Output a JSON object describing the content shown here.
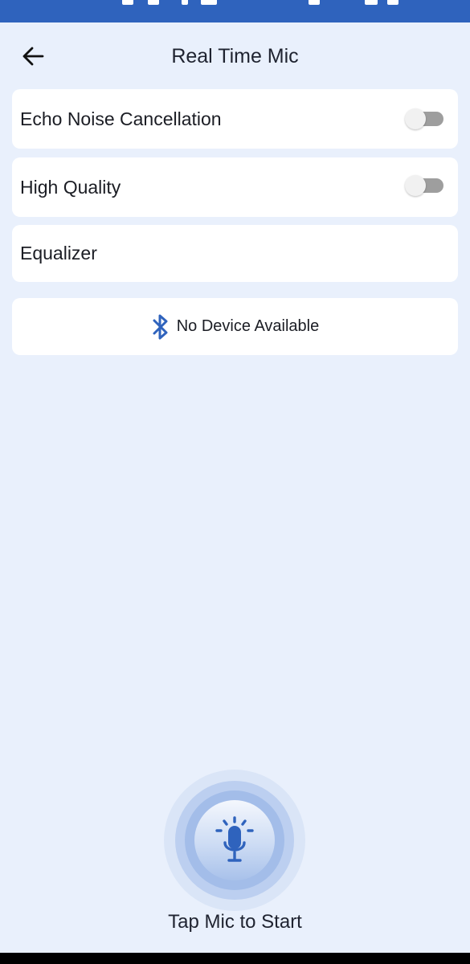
{
  "header": {
    "title": "Real Time Mic"
  },
  "settings": [
    {
      "label": "Echo Noise Cancellation",
      "toggle": false
    },
    {
      "label": "High Quality",
      "toggle": false
    },
    {
      "label": "Equalizer"
    }
  ],
  "device": {
    "text": "No Device Available",
    "icon": "bluetooth-icon"
  },
  "mic": {
    "caption": "Tap Mic to Start",
    "icon": "microphone-icon"
  },
  "colors": {
    "accent": "#2f63bd",
    "background": "#e9f0fc",
    "card": "#ffffff",
    "switch_off_track": "#9e9e9e"
  }
}
